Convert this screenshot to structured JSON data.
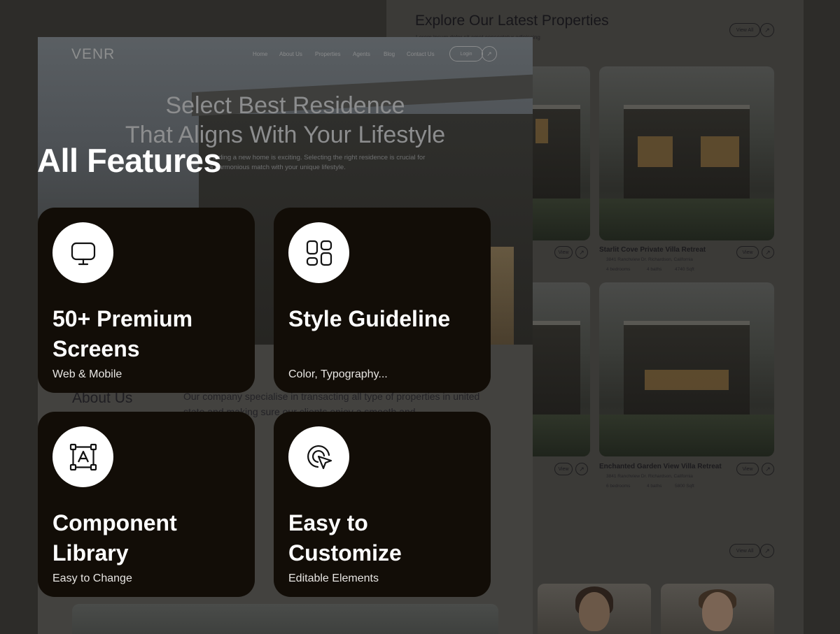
{
  "listing": {
    "title": "Explore Our Latest Properties",
    "subtitle": "Lorem ipsum dolor sit amet consectetur adipiscing",
    "view_all": "View All",
    "arrow": "↗",
    "properties": [
      {
        "name": "Starlit Cove Private Villa Retreat",
        "address": "3841 Ranchview Dr. Richardson, California",
        "bedrooms": "4 bedrooms",
        "baths": "4 baths",
        "size": "4740 Sqft",
        "view": "View"
      },
      {
        "name": "Enchanted Garden View Villa Retreat",
        "address": "3841 Ranchview Dr. Richardson, California",
        "bedrooms": "6 bedrooms",
        "baths": "4 baths",
        "size": "5800 Sqft",
        "view": "View"
      }
    ],
    "left_view_labels": [
      "View",
      "View"
    ]
  },
  "hero": {
    "logo": "VENR",
    "nav": [
      "Home",
      "About Us",
      "Properties",
      "Agents",
      "Blog",
      "Contact Us"
    ],
    "login": "Login",
    "arrow": "↗",
    "heading_line1": "Select Best Residence",
    "heading_line2": "That Aligns With Your Lifestyle",
    "sub_line1": "Finding a new home is exciting. Selecting the right residence is crucial for",
    "sub_line2": "a harmonious match with your unique lifestyle.",
    "about_title": "About Us",
    "about_text": "Our company specialise in transacting all type of properties in united state and making sure our clients enjoy a smooth and"
  },
  "features": {
    "title": "All Features",
    "cards": [
      {
        "icon": "monitor-icon",
        "title": "50+ Premium Screens",
        "subtitle": "Web & Mobile"
      },
      {
        "icon": "grid-icon",
        "title": "Style Guideline",
        "subtitle": "Color, Typography..."
      },
      {
        "icon": "component-icon",
        "title": "Component Library",
        "subtitle": "Easy to Change"
      },
      {
        "icon": "cursor-click-icon",
        "title": "Easy to Customize",
        "subtitle": "Editable Elements"
      }
    ]
  }
}
